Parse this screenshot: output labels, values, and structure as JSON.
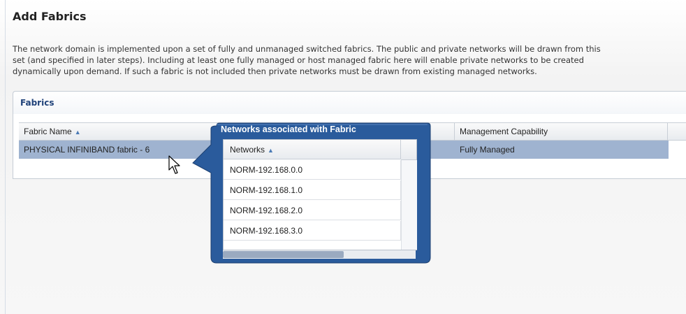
{
  "page": {
    "title": "Add Fabrics",
    "description_lines": [
      "The network domain is implemented upon a set of fully and unmanaged switched fabrics. The public and private networks will be drawn from this",
      "set (and specified in later steps). Including at least one fully managed or host managed fabric here will enable private networks to be created",
      "dynamically upon demand. If such a fabric is not included then private networks must be drawn from existing managed networks."
    ]
  },
  "fabrics_panel": {
    "header": "Fabrics",
    "columns": {
      "fabric_name": "Fabric Name",
      "management_capability": "Management Capability"
    },
    "rows": [
      {
        "fabric_name": "PHYSICAL INFINIBAND fabric - 6",
        "management_capability": "Fully Managed"
      }
    ]
  },
  "callout": {
    "title": "Networks associated with Fabric",
    "column_header": "Networks",
    "rows": [
      "NORM-192.168.0.0",
      "NORM-192.168.1.0",
      "NORM-192.168.2.0",
      "NORM-192.168.3.0"
    ]
  },
  "colors": {
    "callout_blue": "#2a5b9c",
    "selected_row": "#9fb3d0",
    "panel_header_text": "#21437a"
  },
  "icons": {
    "sort": "sort-ascending-icon",
    "cursor": "mouse-pointer-icon"
  }
}
